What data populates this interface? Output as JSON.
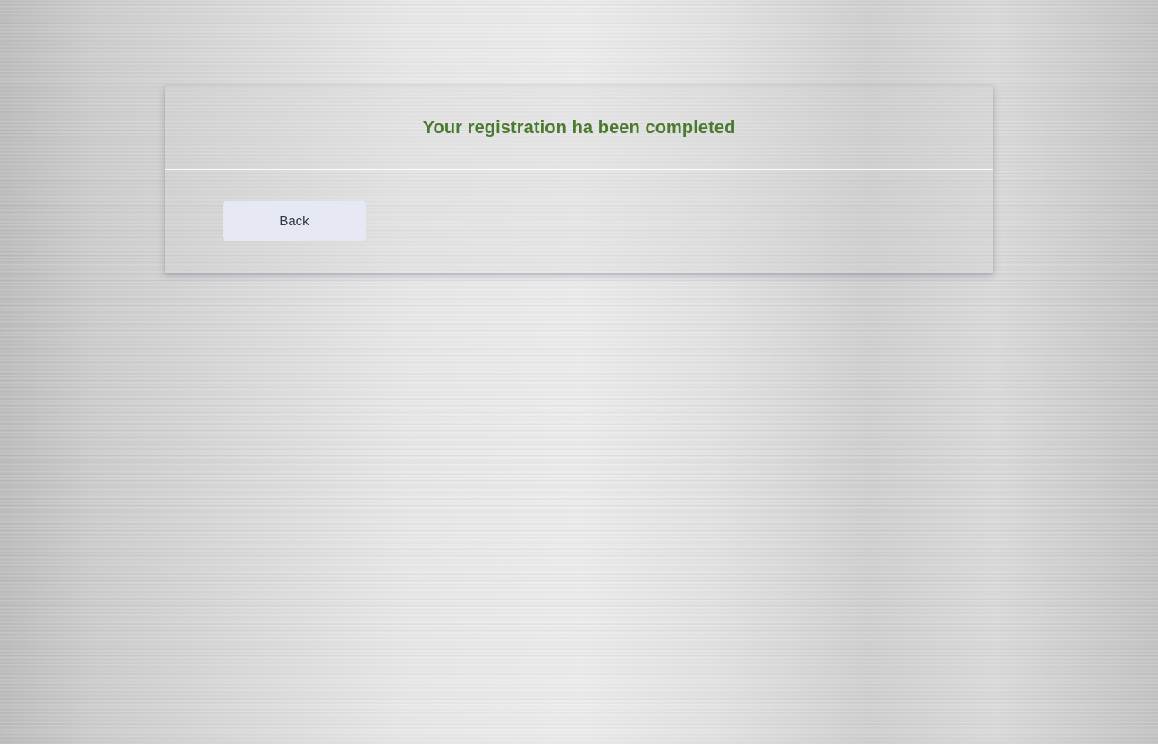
{
  "registration_panel": {
    "title": "Your registration ha been completed",
    "back_label": "Back"
  },
  "colors": {
    "title_text": "#4a7a2f",
    "button_background": "#e6e8f4",
    "button_text": "#2f3440"
  }
}
